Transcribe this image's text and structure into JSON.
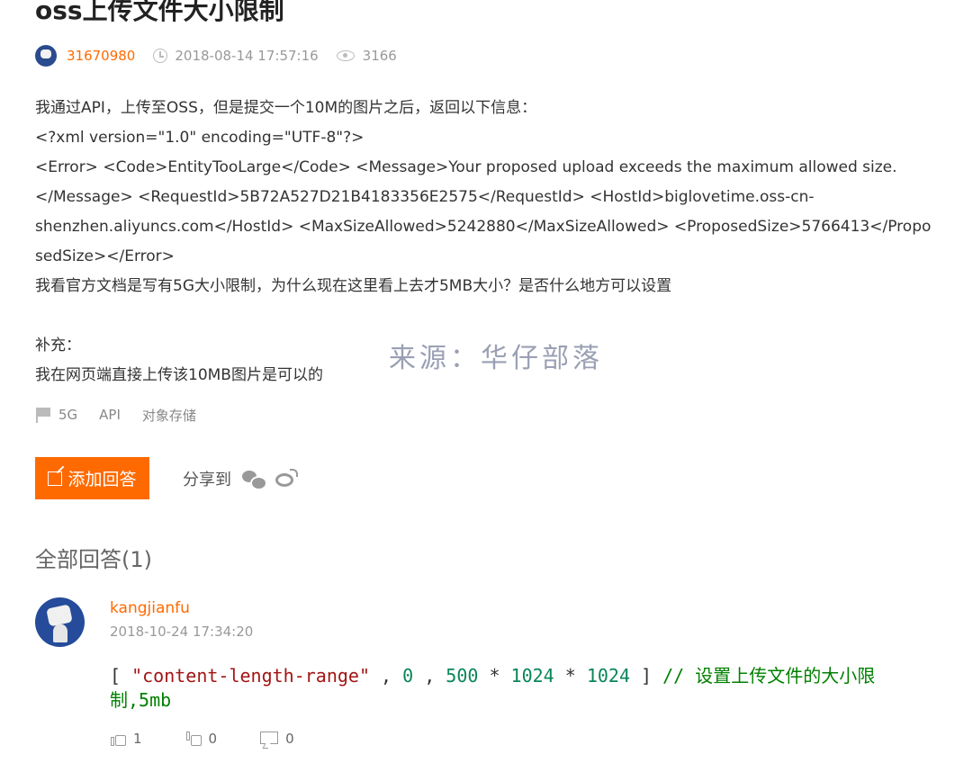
{
  "post": {
    "title": "oss上传文件大小限制",
    "author": "31670980",
    "date": "2018-08-14 17:57:16",
    "views": "3166"
  },
  "body": {
    "lines": [
      "我通过API，上传至OSS，但是提交一个10M的图片之后，返回以下信息：",
      "<?xml version=\"1.0\" encoding=\"UTF-8\"?>",
      "<Error>  <Code>EntityTooLarge</Code>  <Message>Your proposed upload exceeds the maximum allowed size.",
      "</Message>  <RequestId>5B72A527D21B4183356E2575</RequestId>  <HostId>biglovetime.oss-cn-",
      "shenzhen.aliyuncs.com</HostId>  <MaxSizeAllowed>5242880</MaxSizeAllowed>  <ProposedSize>5766413</Propo",
      "sedSize></Error>",
      "我看官方文档是写有5G大小限制，为什么现在这里看上去才5MB大小？是否什么地方可以设置"
    ],
    "supplement_label": "补充：",
    "supplement_text": "我在网页端直接上传该10MB图片是可以的",
    "watermark": "来源：华仔部落"
  },
  "tags": [
    "5G",
    "API",
    "对象存储"
  ],
  "actions": {
    "add_answer": "添加回答",
    "share_label": "分享到"
  },
  "answers": {
    "header": "全部回答(1)",
    "items": [
      {
        "author": "kangjianfu",
        "date": "2018-10-24 17:34:20",
        "code": {
          "open": "[ ",
          "str": "\"content-length-range\"",
          "sep1": " , ",
          "n1": "0",
          "sep2": " , ",
          "n2": "500",
          "op1": " * ",
          "n3": "1024",
          "op2": " * ",
          "n4": "1024",
          "close": " ] ",
          "comment": "// 设置上传文件的大小限制,5mb"
        },
        "likes": "1",
        "dislikes": "0",
        "comments": "0"
      }
    ]
  }
}
